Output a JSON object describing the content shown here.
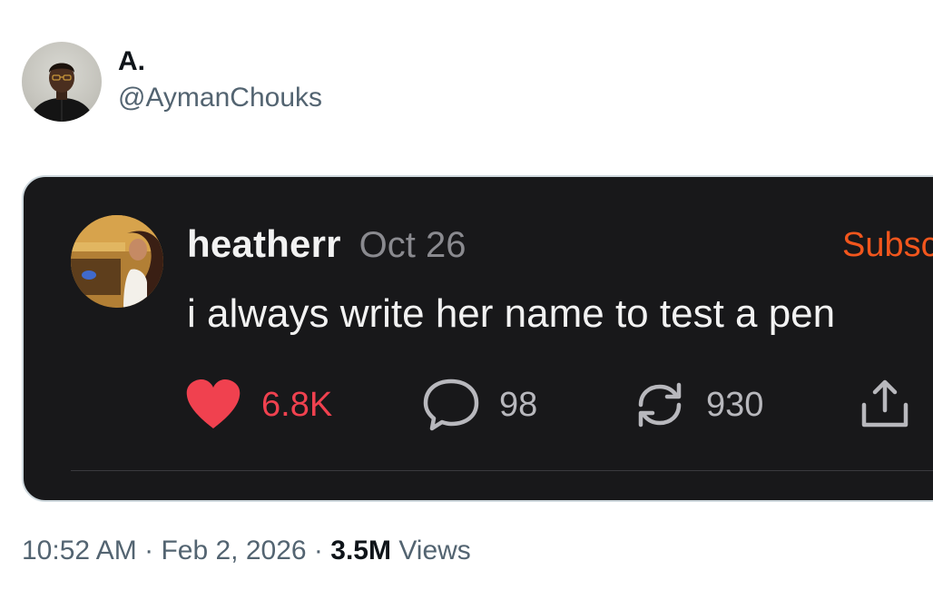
{
  "author": {
    "display_name": "A.",
    "handle": "@AymanChouks"
  },
  "card": {
    "username": "heatherr",
    "date": "Oct 26",
    "subscribe_label": "Subsc",
    "text": "i always write her name to test a pen",
    "actions": {
      "likes": "6.8K",
      "comments": "98",
      "reposts": "930"
    },
    "colors": {
      "background": "#18181a",
      "like": "#f0414f",
      "subscribe": "#f2561d"
    },
    "icons": [
      "heart-icon",
      "comment-icon",
      "repost-icon",
      "share-icon"
    ]
  },
  "meta": {
    "time": "10:52 AM",
    "separator": "·",
    "date": "Feb 2, 2026",
    "views_count": "3.5M",
    "views_label": "Views"
  }
}
